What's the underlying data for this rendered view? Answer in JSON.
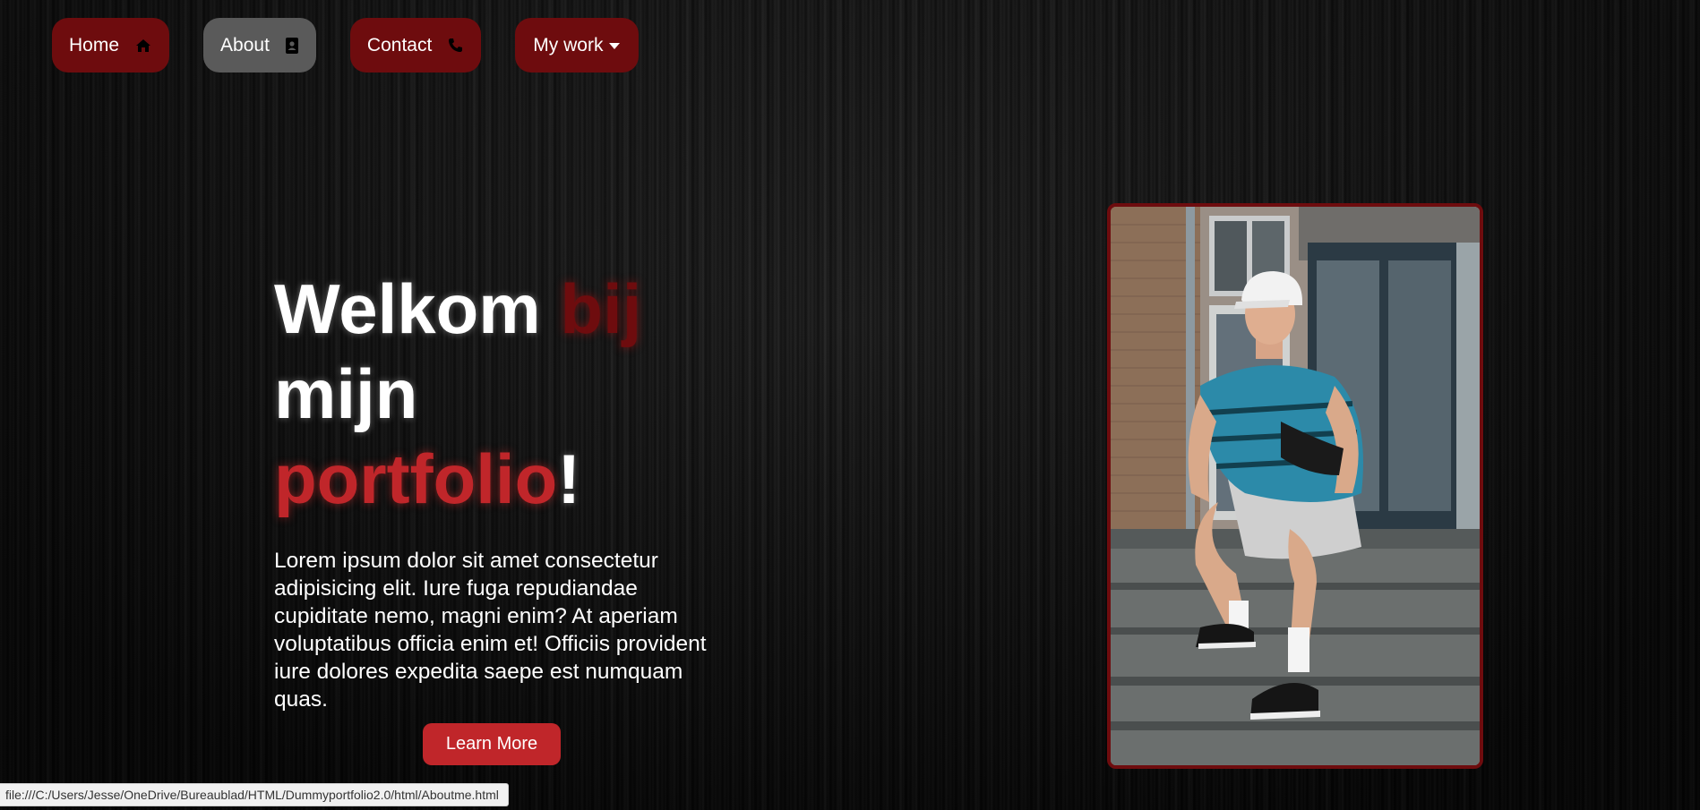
{
  "nav": {
    "home": {
      "label": "Home",
      "icon": "home-icon"
    },
    "about": {
      "label": "About",
      "icon": "contact-book-icon"
    },
    "contact": {
      "label": "Contact",
      "icon": "phone-icon"
    },
    "work": {
      "label": "My work",
      "icon": "caret-down-icon"
    }
  },
  "hero": {
    "welcome": "Welkom",
    "bij": "bij",
    "mijn": "mijn",
    "portfolio": "portfolio",
    "exclamation": "!",
    "text": "Lorem ipsum dolor sit amet consectetur adipisicing elit. Iure fuga repudiandae cupiditate nemo, magni enim? At aperiam voluptatibus officia enim et! Officiis provident iure dolores expedita saepe est numquam quas.",
    "button": "Learn More"
  },
  "status_bar": {
    "url": "file:///C:/Users/Jesse/OneDrive/Bureaublad/HTML/Dummyportfolio2.0/html/Aboutme.html"
  },
  "colors": {
    "dark_red": "#6e0c0e",
    "red": "#c0262a",
    "active_nav": "#5a5a5a"
  }
}
